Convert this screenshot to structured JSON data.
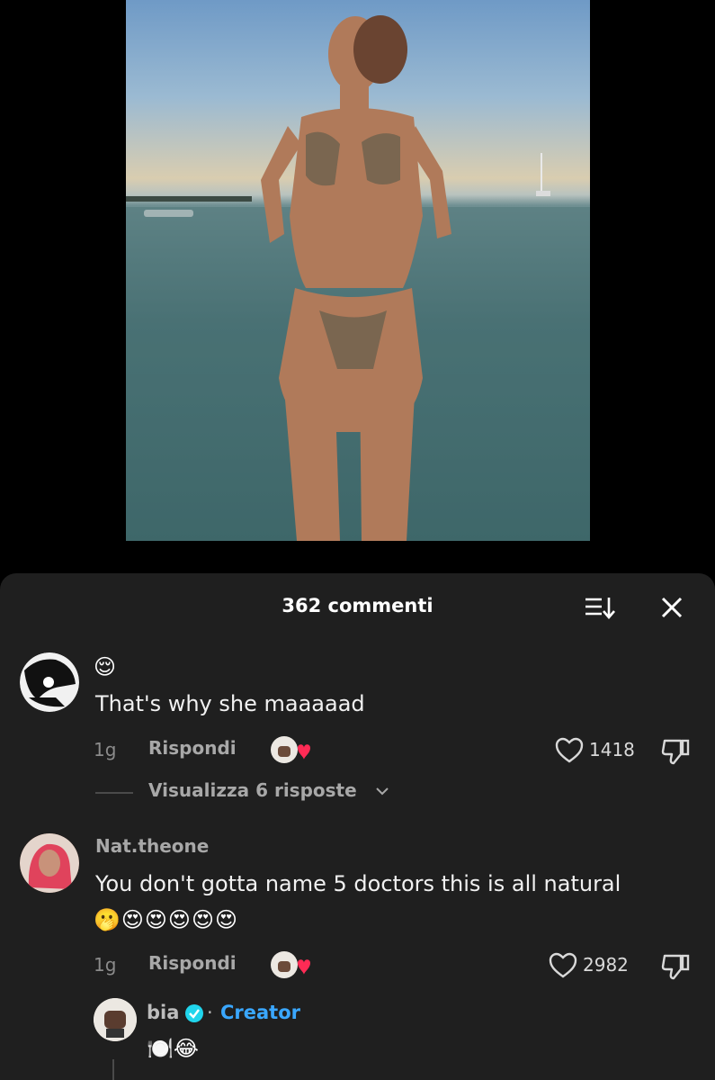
{
  "sheet": {
    "title": "362 commenti",
    "sort_icon": "sort-icon",
    "close_icon": "close-icon"
  },
  "comments": [
    {
      "username": "",
      "emoji": "😌",
      "text": "That's why she maaaaad",
      "time": "1g",
      "reply_label": "Rispondi",
      "likes": "1418",
      "view_replies": "Visualizza 6 risposte"
    },
    {
      "username": "Nat.theone",
      "text": "You don't gotta name 5 doctors this is all natural",
      "emoji": "🫢😍😍😍😍😍",
      "time": "1g",
      "reply_label": "Rispondi",
      "likes": "2982"
    }
  ],
  "creator_reply": {
    "username": "bia",
    "separator": "·",
    "badge": "Creator",
    "text": "🍽️😂"
  },
  "colors": {
    "sheet_bg": "#1f1f1f",
    "creator_accent": "#3aa7ff",
    "like_heart_pink": "#ff2b55"
  }
}
